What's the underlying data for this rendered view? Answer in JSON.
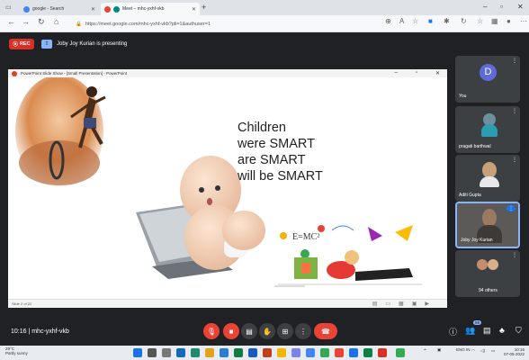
{
  "browser": {
    "tabs": [
      {
        "label": "google - Search",
        "active": false,
        "favicon_color": "#4285f4"
      },
      {
        "label": "Meet – mhc-yxhf-vkb",
        "active": true,
        "favicon_color": "#ea4335"
      }
    ],
    "url": "https://meet.google.com/mhc-yxhf-vkb?pli=1&authuser=1",
    "new_tab_label": "+",
    "icons": [
      "back-icon",
      "forward-icon",
      "reload-icon",
      "home-icon",
      "bookmark-icon",
      "extensions-icon",
      "profile-icon",
      "menu-icon"
    ]
  },
  "meet": {
    "rec_label": "REC",
    "presenting_text": "Joby Joy Kurian is presenting",
    "meeting_code": "10:16  |  mhc-yxhf-vkb",
    "participants": [
      {
        "name": "You",
        "initial": "D",
        "avatar_color": "#5f6bd8"
      },
      {
        "name": "pragati barthwal"
      },
      {
        "name": "Aditi Gupta"
      },
      {
        "name": "Joby Joy Kurian"
      },
      {
        "name": "94 others"
      }
    ],
    "people_count": "99",
    "controls": [
      "mic-off",
      "camera-off",
      "captions",
      "raise-hand",
      "present",
      "more",
      "end-call"
    ]
  },
  "presentation": {
    "window_title": "PowerPoint Slide Show - [Small Presentation] - PowerPoint",
    "slide_lines": [
      "Children",
      "were SMART",
      "are SMART",
      "will be SMART"
    ],
    "formula": "E=MC²",
    "status_text": "Slide 2 of 22"
  },
  "taskbar": {
    "weather_temp": "29°C",
    "weather_desc": "Partly sunny",
    "time": "10:16",
    "date": "07-05-2022",
    "lang": "ENG IN"
  }
}
